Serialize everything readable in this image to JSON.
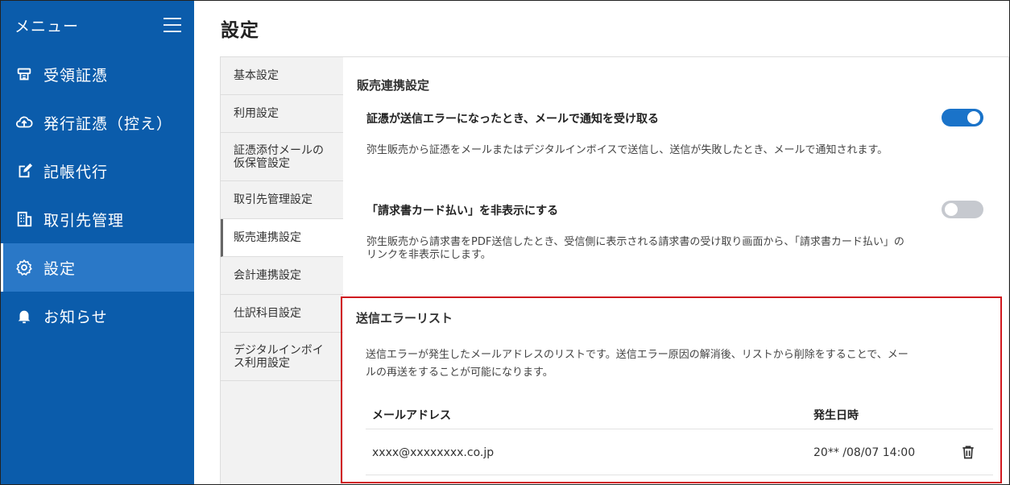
{
  "sidebar": {
    "title": "メニュー",
    "items": [
      {
        "label": "受領証憑",
        "icon": "receipt-icon"
      },
      {
        "label": "発行証憑（控え）",
        "icon": "cloud-upload-icon"
      },
      {
        "label": "記帳代行",
        "icon": "edit-icon"
      },
      {
        "label": "取引先管理",
        "icon": "building-icon"
      },
      {
        "label": "設定",
        "icon": "gear-icon",
        "active": true
      },
      {
        "label": "お知らせ",
        "icon": "bell-icon"
      }
    ]
  },
  "page": {
    "title": "設定"
  },
  "tabs": [
    {
      "label": "基本設定"
    },
    {
      "label": "利用設定"
    },
    {
      "label": "証憑添付メールの仮保管設定"
    },
    {
      "label": "取引先管理設定"
    },
    {
      "label": "販売連携設定",
      "active": true
    },
    {
      "label": "会計連携設定"
    },
    {
      "label": "仕訳科目設定"
    },
    {
      "label": "デジタルインボイス利用設定"
    }
  ],
  "sales_link": {
    "section_title": "販売連携設定",
    "settings": [
      {
        "label": "証憑が送信エラーになったとき、メールで通知を受け取る",
        "description": "弥生販売から証憑をメールまたはデジタルインボイスで送信し、送信が失敗したとき、メールで通知されます。",
        "enabled": true
      },
      {
        "label": "「請求書カード払い」を非表示にする",
        "description_line1": "弥生販売から請求書をPDF送信したとき、受信側に表示される請求書の受け取り画面から、「請求書カード払い」の",
        "description_line2": "リンクを非表示にします。",
        "enabled": false
      }
    ]
  },
  "error_list": {
    "title": "送信エラーリスト",
    "description_line1": "送信エラーが発生したメールアドレスのリストです。送信エラー原因の解消後、リストから削除をすることで、メー",
    "description_line2": "ルの再送をすることが可能になります。",
    "columns": [
      "メールアドレス",
      "発生日時"
    ],
    "rows": [
      {
        "email": "xxxx@xxxxxxxx.co.jp",
        "datetime": "20** /08/07 14:00",
        "action_icon": "trash-icon"
      }
    ]
  },
  "colors": {
    "sidebar_bg": "#0b5cab",
    "sidebar_active": "#2a78c7",
    "toggle_on": "#1a73c9",
    "toggle_off": "#c6c9cf",
    "highlight": "#d0191f"
  }
}
